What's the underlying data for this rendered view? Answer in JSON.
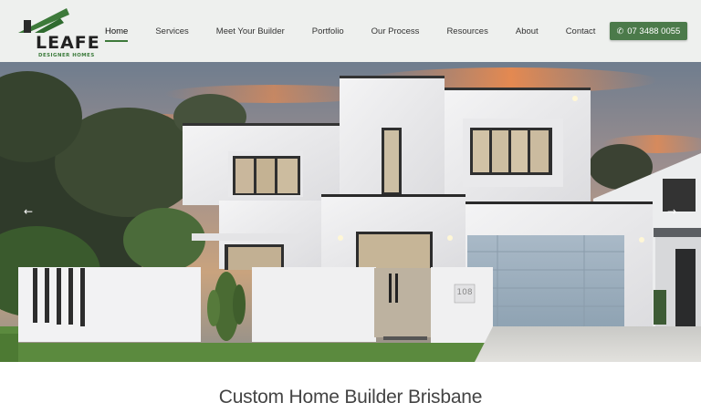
{
  "logo": {
    "name": "LEAFE",
    "tagline": "DESIGNER HOMES"
  },
  "nav": {
    "items": [
      {
        "label": "Home",
        "active": true
      },
      {
        "label": "Services",
        "active": false
      },
      {
        "label": "Meet Your Builder",
        "active": false
      },
      {
        "label": "Portfolio",
        "active": false
      },
      {
        "label": "Our Process",
        "active": false
      },
      {
        "label": "Resources",
        "active": false
      },
      {
        "label": "About",
        "active": false
      },
      {
        "label": "Contact",
        "active": false
      }
    ]
  },
  "cta": {
    "phone": "07 3488 0055",
    "icon": "phone-icon"
  },
  "hero": {
    "house_number": "108",
    "prev_icon": "arrow-left-icon",
    "next_icon": "arrow-right-icon"
  },
  "heading": "Custom Home Builder Brisbane",
  "colors": {
    "brand_green": "#4b7a4a",
    "header_bg": "#eef0ee",
    "text": "#333333"
  }
}
